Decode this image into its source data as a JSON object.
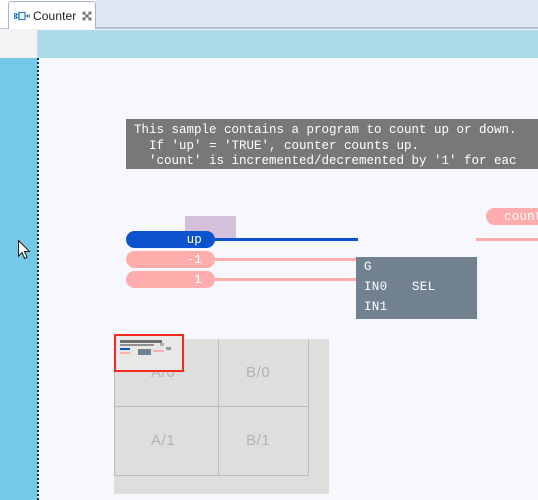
{
  "window": {
    "tab": {
      "label": "Counter",
      "icon": "function-block-diagram-icon",
      "close_icon": "close-icon"
    }
  },
  "editor": {
    "comment": {
      "line1": "This sample contains a program to count up or down.",
      "line2": "  If 'up' = 'TRUE', counter counts up.",
      "line3": "  'count' is incremented/decremented by '1' for eac"
    },
    "annotation": {
      "text": ""
    },
    "inputs": [
      {
        "label": "up",
        "style": "blue"
      },
      {
        "label": "-1",
        "style": "pink"
      },
      {
        "label": "1",
        "style": "pink"
      }
    ],
    "function_block": {
      "name": "SEL",
      "ports": [
        "G",
        "IN0",
        "IN1"
      ]
    },
    "output": {
      "label": "count"
    },
    "page_grid": {
      "cells": [
        "A/0",
        "B/0",
        "A/1",
        "B/1"
      ]
    }
  },
  "colors": {
    "wire_blue": "#0b52cd",
    "wire_pink": "#ffacac",
    "block_gray": "#72818f",
    "comment_gray": "#787878",
    "annotation_purple": "#d5c0db",
    "band_blue": "#74c8e8",
    "header_blue": "#aedbe8",
    "selection_red": "#f42a1e",
    "canvas": "#f6f8fd"
  }
}
